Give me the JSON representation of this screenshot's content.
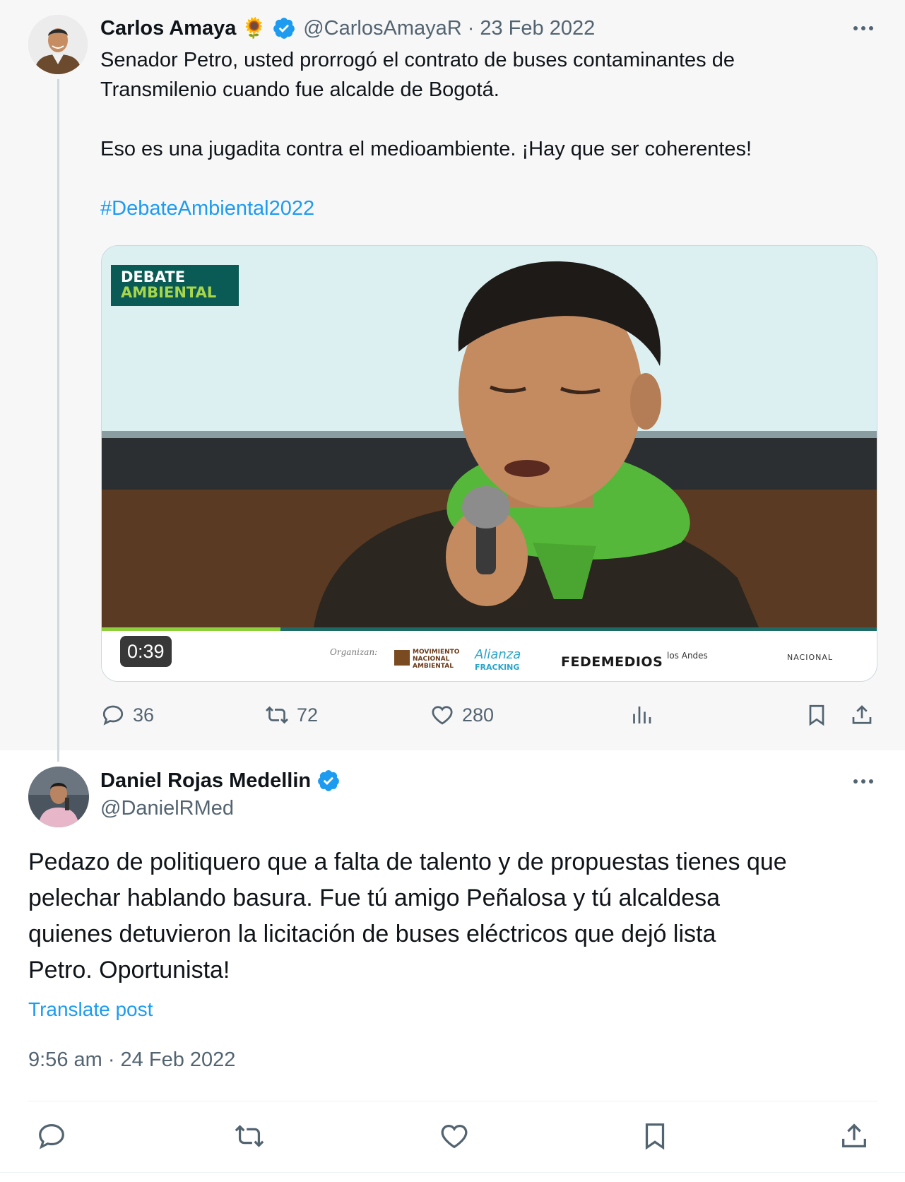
{
  "parent_tweet": {
    "display_name": "Carlos Amaya",
    "name_emoji": "🌻",
    "handle": "@CarlosAmayaR",
    "separator": "·",
    "date": "23 Feb 2022",
    "text_line1": "Senador Petro, usted prorrogó el contrato de buses contaminantes de",
    "text_line2": "Transmilenio cuando fue alcalde de Bogotá.",
    "text_line3": "Eso es una jugadita contra el medioambiente. ¡Hay que ser coherentes!",
    "hashtag": "#DebateAmbiental2022",
    "video": {
      "duration": "0:39",
      "progress_fraction": 0.23,
      "overlay_logo_line1": "DEBATE",
      "overlay_logo_line2": "AMBIENTAL",
      "sponsors_label": "Organizan:",
      "sponsor_1": "MOVIMIENTO NACIONAL AMBIENTAL",
      "sponsor_2": "Alianza",
      "sponsor_2b": "FRACKING",
      "sponsor_3": "FEDEMEDIOS",
      "sponsor_4": "los Andes",
      "sponsor_5": "NACIONAL"
    },
    "replies": "36",
    "reposts": "72",
    "likes": "280"
  },
  "reply_tweet": {
    "display_name": "Daniel Rojas Medellin",
    "handle": "@DanielRMed",
    "text_line1": "Pedazo de politiquero que a falta de talento y de propuestas tienes que",
    "text_line2": "pelechar hablando basura. Fue tú amigo Peñalosa y tú alcaldesa",
    "text_line3": "quienes detuvieron la licitación de buses eléctricos que dejó lista",
    "text_line4": "Petro. Oportunista!",
    "translate_label": "Translate post",
    "timestamp": "9:56 am · 24 Feb 2022"
  },
  "icons": {
    "reply": "reply-icon",
    "repost": "repost-icon",
    "like": "heart-icon",
    "views": "analytics-icon",
    "bookmark": "bookmark-icon",
    "share": "share-icon",
    "more": "more-icon",
    "verified": "verified-badge-icon"
  },
  "colors": {
    "link": "#1d9bf0",
    "secondary_text": "#536471",
    "verified": "#1d9bf0",
    "parent_background": "#f7f7f7"
  }
}
